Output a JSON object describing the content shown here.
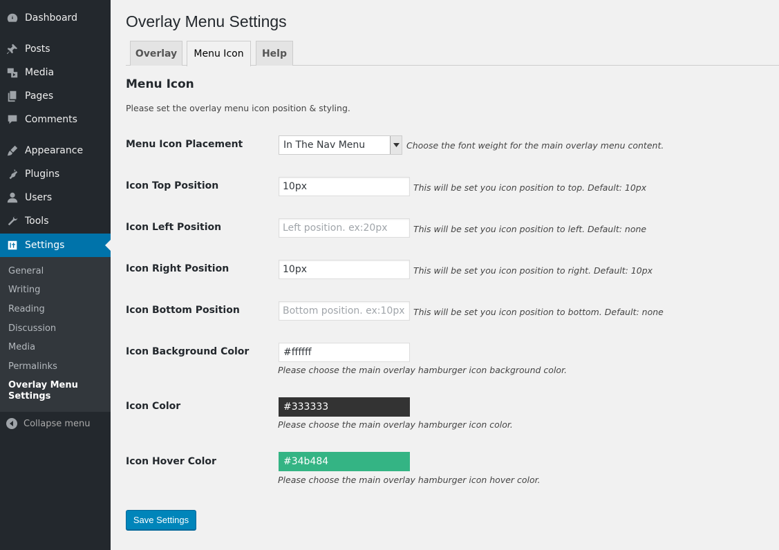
{
  "sidebar": {
    "items": [
      {
        "label": "Dashboard",
        "icon": "dashboard-icon"
      },
      {
        "label": "Posts",
        "icon": "pin-icon"
      },
      {
        "label": "Media",
        "icon": "media-icon"
      },
      {
        "label": "Pages",
        "icon": "pages-icon"
      },
      {
        "label": "Comments",
        "icon": "comment-icon"
      },
      {
        "label": "Appearance",
        "icon": "brush-icon"
      },
      {
        "label": "Plugins",
        "icon": "plugin-icon"
      },
      {
        "label": "Users",
        "icon": "user-icon"
      },
      {
        "label": "Tools",
        "icon": "wrench-icon"
      },
      {
        "label": "Settings",
        "icon": "settings-icon"
      }
    ],
    "submenu": [
      "General",
      "Writing",
      "Reading",
      "Discussion",
      "Media",
      "Permalinks",
      "Overlay Menu Settings"
    ],
    "collapse_label": "Collapse menu"
  },
  "page": {
    "title": "Overlay Menu Settings",
    "tabs": [
      "Overlay",
      "Menu Icon",
      "Help"
    ],
    "section_title": "Menu Icon",
    "section_desc": "Please set the overlay menu icon position & styling."
  },
  "form": {
    "placement": {
      "label": "Menu Icon Placement",
      "value": "In The Nav Menu",
      "hint": "Choose the font weight for the main overlay menu content."
    },
    "top": {
      "label": "Icon Top Position",
      "value": "10px",
      "placeholder": "",
      "hint": "This will be set you icon position to top. Default: 10px"
    },
    "left": {
      "label": "Icon Left Position",
      "value": "",
      "placeholder": "Left position. ex:20px",
      "hint": "This will be set you icon position to left. Default: none"
    },
    "right": {
      "label": "Icon Right Position",
      "value": "10px",
      "placeholder": "",
      "hint": "This will be set you icon position to right. Default: 10px"
    },
    "bottom": {
      "label": "Icon Bottom Position",
      "value": "",
      "placeholder": "Bottom position. ex:10px",
      "hint": "This will be set you icon position to bottom. Default: none"
    },
    "bg_color": {
      "label": "Icon Background Color",
      "value": "#ffffff",
      "hint": "Please choose the main overlay hamburger icon background color."
    },
    "icon_color": {
      "label": "Icon Color",
      "value": "#333333",
      "hint": "Please choose the main overlay hamburger icon color."
    },
    "hover_color": {
      "label": "Icon Hover Color",
      "value": "#34b484",
      "hint": "Please choose the main overlay hamburger icon hover color."
    },
    "save_label": "Save Settings"
  },
  "colors": {
    "sidebar_bg": "#23282d",
    "accent": "#0073aa",
    "icon_color_swatch": "#333333",
    "hover_color_swatch": "#34b484"
  }
}
